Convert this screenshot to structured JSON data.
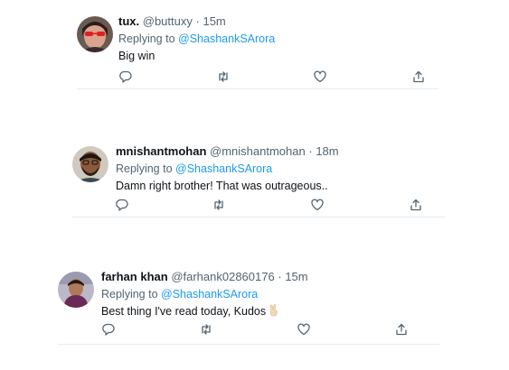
{
  "tweets": [
    {
      "display_name": "tux.",
      "handle": "@buttuxy",
      "separator": "·",
      "time": "15m",
      "replying_prefix": "Replying to",
      "replying_to": "@ShashankSArora",
      "text": "Big win"
    },
    {
      "display_name": "mnishantmohan",
      "handle": "@mnishantmohan",
      "separator": "·",
      "time": "18m",
      "replying_prefix": "Replying to",
      "replying_to": "@ShashankSArora",
      "text": "Damn right brother! That was outrageous.."
    },
    {
      "display_name": "farhan khan",
      "handle": "@farhank02860176",
      "separator": "·",
      "time": "15m",
      "replying_prefix": "Replying to",
      "replying_to": "@ShashankSArora",
      "text": "Best thing I've read today, Kudos",
      "emoji_icon": "victory-hand-icon"
    }
  ],
  "actions": [
    "reply-icon",
    "retweet-icon",
    "like-icon",
    "share-icon"
  ],
  "colors": {
    "mention": "#1d9bf0",
    "secondary_text": "#536471",
    "primary_text": "#0f1419",
    "divider": "#e6ecf0"
  }
}
